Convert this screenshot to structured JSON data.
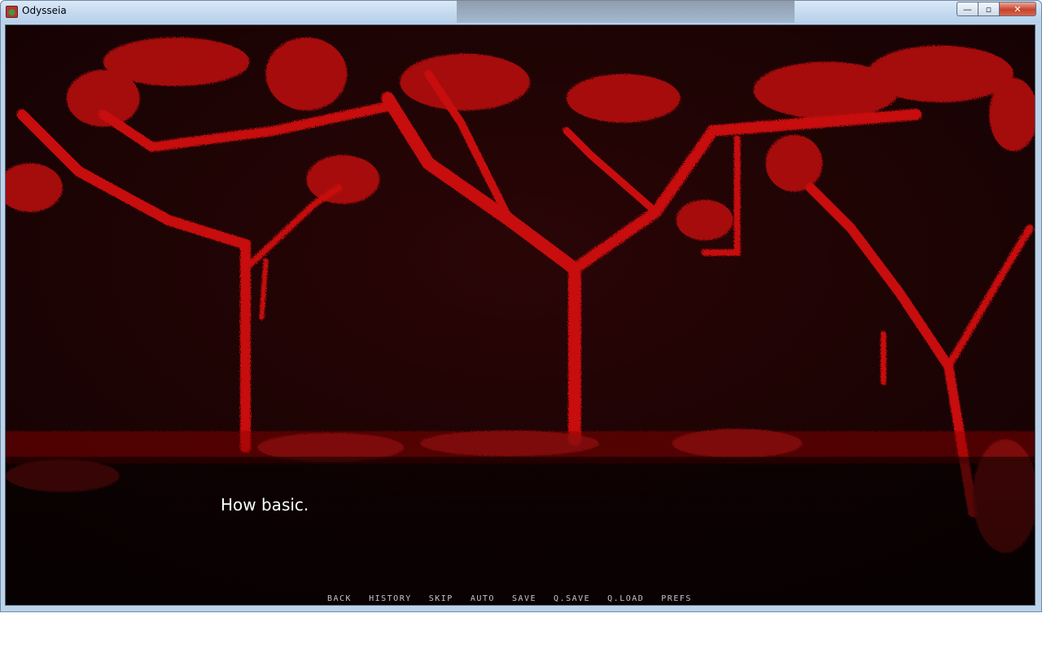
{
  "window": {
    "title": "Odysseia",
    "controls": {
      "minimize": "—",
      "maximize": "▫",
      "close": "✕"
    }
  },
  "scene": {
    "background": "blood-red tree silhouettes",
    "colors": {
      "sky": "#1a0304",
      "tree": "#c40a0a"
    }
  },
  "dialogue": {
    "text": "How basic."
  },
  "quick_menu": {
    "items": [
      {
        "label": "BACK"
      },
      {
        "label": "HISTORY"
      },
      {
        "label": "SKIP"
      },
      {
        "label": "AUTO"
      },
      {
        "label": "SAVE"
      },
      {
        "label": "Q.SAVE"
      },
      {
        "label": "Q.LOAD"
      },
      {
        "label": "PREFS"
      }
    ]
  }
}
